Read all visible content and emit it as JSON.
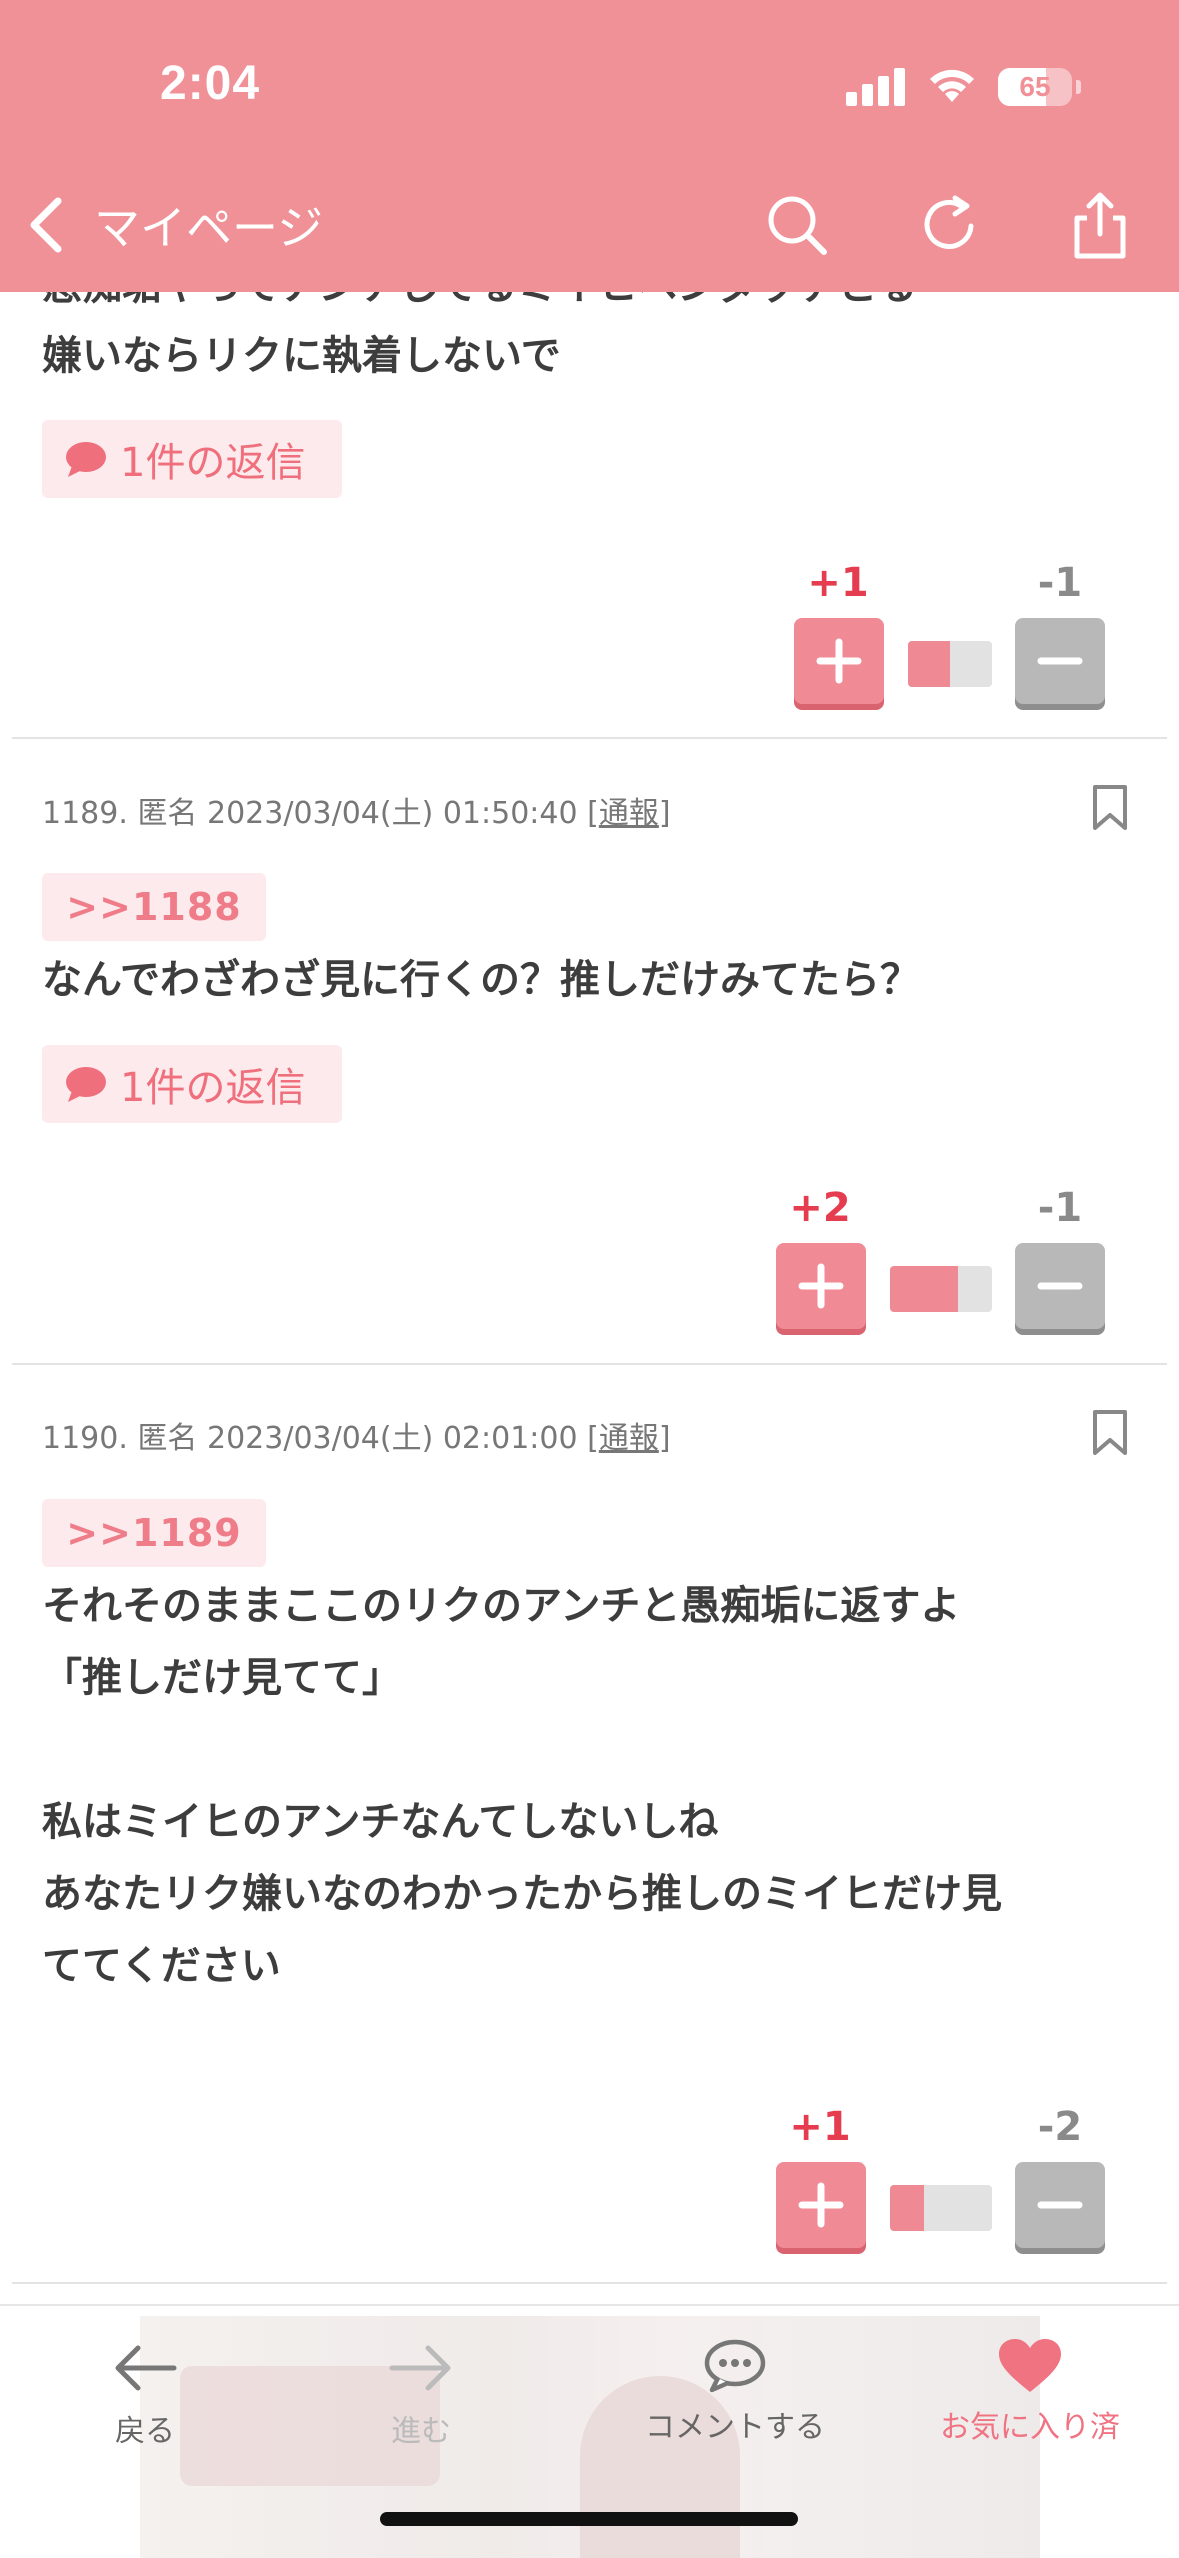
{
  "status_bar": {
    "time": "2:04",
    "battery": "65"
  },
  "header": {
    "back_label": "マイページ"
  },
  "comments": [
    {
      "partial_line": "愚痴垢やってアンチしてるミイヒペンダッテとる",
      "body": "嫌いならリクに執着しないで",
      "reply_label": "1件の返信",
      "plus_score": "+1",
      "minus_score": "-1",
      "plus_ratio": 0.5
    },
    {
      "number": "1189.",
      "author": "匿名",
      "datetime": "2023/03/04(土) 01:50:40",
      "report_label": "通報",
      "anchor": ">>1188",
      "body": "なんでわざわざ見に行くの？推しだけみてたら？",
      "reply_label": "1件の返信",
      "plus_score": "+2",
      "minus_score": "-1",
      "plus_ratio": 0.667
    },
    {
      "number": "1190.",
      "author": "匿名",
      "datetime": "2023/03/04(土) 02:01:00",
      "report_label": "通報",
      "anchor": ">>1189",
      "body_lines": [
        "それそのままここのリクのアンチと愚痴垢に返すよ",
        "「推しだけ見てて」",
        "",
        "私はミイヒのアンチなんてしないしね",
        "あなたリク嫌いなのわかったから推しのミイヒだけ見",
        "ててください"
      ],
      "plus_score": "+1",
      "minus_score": "-2",
      "plus_ratio": 0.333
    }
  ],
  "bottom_nav": {
    "back": "戻る",
    "forward": "進む",
    "comment": "コメントする",
    "favorite": "お気に入り済"
  },
  "colors": {
    "accent": "#f09097",
    "plus": "#e53d4f",
    "minus": "#8a8a8a"
  }
}
